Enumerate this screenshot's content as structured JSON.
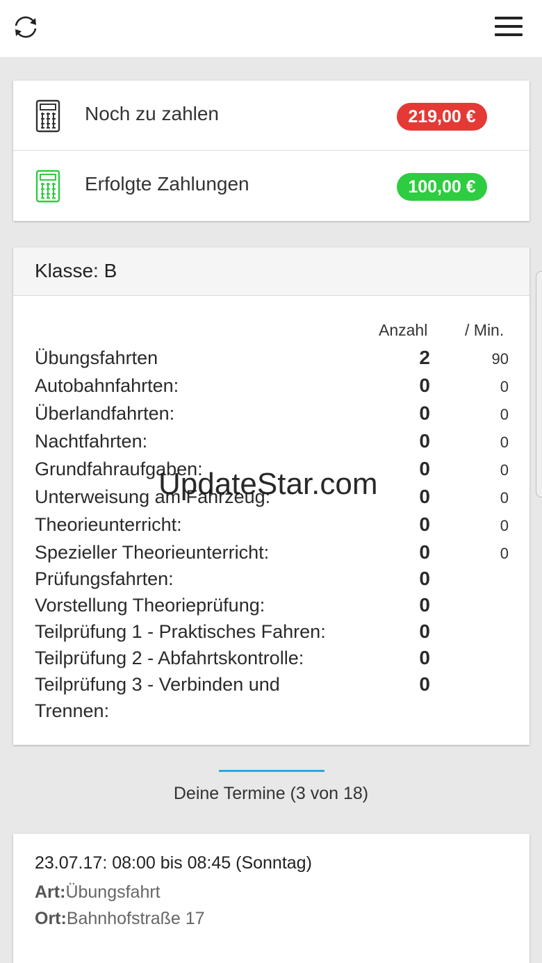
{
  "topbar": {
    "refresh_icon": "refresh-icon",
    "menu_icon": "hamburger-menu-icon"
  },
  "payments": {
    "outstanding": {
      "label": "Noch zu zahlen",
      "amount": "219,00 €",
      "color": "#e53935",
      "icon": "calculator-icon"
    },
    "paid": {
      "label": "Erfolgte Zahlungen",
      "amount": "100,00 €",
      "color": "#2ecc40",
      "icon": "calculator-green-icon"
    }
  },
  "license_class": {
    "title": "Klasse: B",
    "col_count": "Anzahl",
    "col_min": "/ Min.",
    "rows": [
      {
        "name": "Übungsfahrten",
        "count": "2",
        "min": "90"
      },
      {
        "name": "Autobahnfahrten:",
        "count": "0",
        "min": "0"
      },
      {
        "name": "Überlandfahrten:",
        "count": "0",
        "min": "0"
      },
      {
        "name": "Nachtfahrten:",
        "count": "0",
        "min": "0"
      },
      {
        "name": "Grundfahraufgaben:",
        "count": "0",
        "min": "0"
      },
      {
        "name": "Unterweisung am Fahrzeug:",
        "count": "0",
        "min": "0"
      },
      {
        "name": "Theorieunterricht:",
        "count": "0",
        "min": "0"
      },
      {
        "name": "Spezieller Theorieunterricht:",
        "count": "0",
        "min": "0"
      },
      {
        "name": "Prüfungsfahrten:",
        "count": "0",
        "min": ""
      },
      {
        "name": "Vorstellung Theorieprüfung:",
        "count": "0",
        "min": ""
      },
      {
        "name": "Teilprüfung 1 - Praktisches Fahren:",
        "count": "0",
        "min": ""
      },
      {
        "name": "Teilprüfung 2 - Abfahrtskontrolle:",
        "count": "0",
        "min": ""
      },
      {
        "name": "Teilprüfung 3 - Verbinden und",
        "name2": "Trennen:",
        "count": "0",
        "min": ""
      }
    ]
  },
  "appointments": {
    "title": "Deine Termine (3 von 18)",
    "items": [
      {
        "time": "23.07.17: 08:00 bis 08:45 (Sonntag)",
        "type_label": "Art:",
        "type": "Übungsfahrt",
        "place_label": "Ort:",
        "place": "Bahnhofstraße 17"
      }
    ]
  },
  "watermark": "UpdateStar.com",
  "colors": {
    "accent": "#29a8e0",
    "background": "#e8e8e8"
  }
}
